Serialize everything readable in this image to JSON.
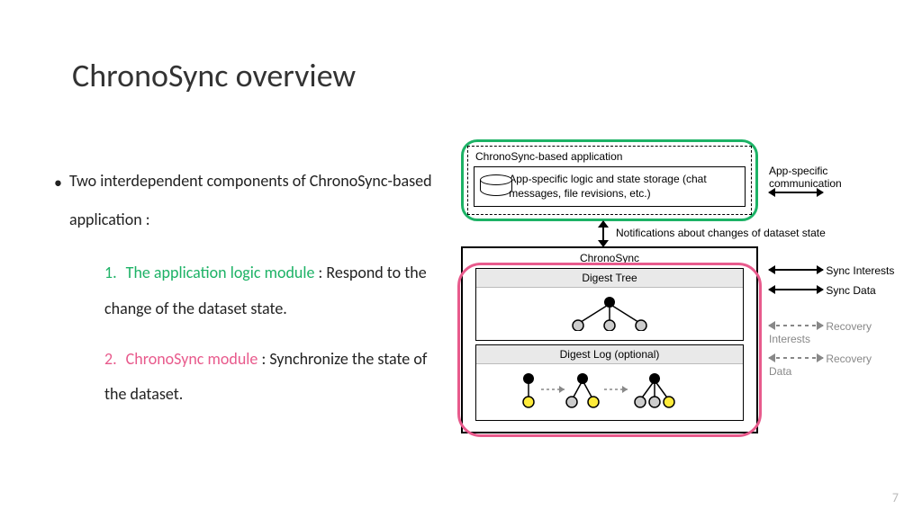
{
  "title": "ChronoSync overview",
  "bullet": {
    "main": "Two interdependent components of ChronoSync-based application :",
    "items": [
      {
        "num": "1.",
        "colorClass": "green",
        "strong": "The application logic module",
        "rest": " : Respond to the change of the dataset state."
      },
      {
        "num": "2.",
        "colorClass": "pink",
        "strong": "ChronoSync module",
        "rest": " : Synchronize the state of the dataset."
      }
    ]
  },
  "diagram": {
    "app_title": "ChronoSync-based application",
    "app_desc": "App-specific logic and state storage (chat messages, file revisions, etc.)",
    "app_comm": "App-specific communication",
    "notif": "Notifications about changes of dataset state",
    "chrono_title": "ChronoSync",
    "digest_tree": "Digest Tree",
    "digest_log": "Digest Log (optional)",
    "arrows": {
      "sync_interests": "Sync Interests",
      "sync_data": "Sync Data",
      "recovery_interests": "Recovery Interests",
      "recovery_data": "Recovery Data"
    }
  },
  "page_number": "7"
}
